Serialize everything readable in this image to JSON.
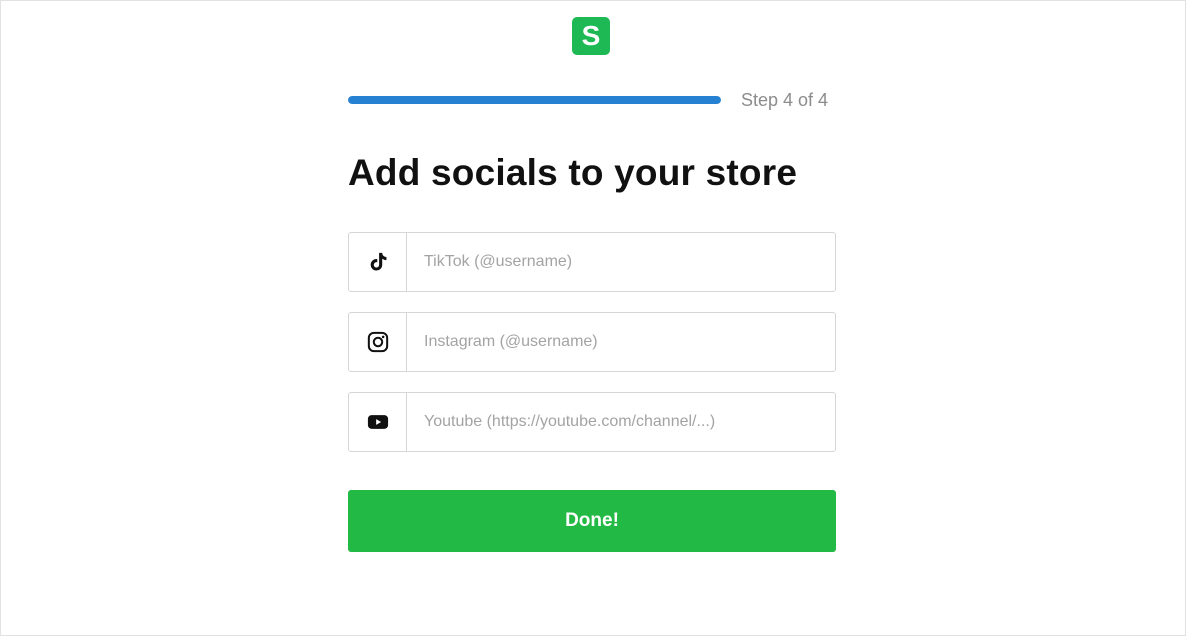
{
  "logo": {
    "letter": "S",
    "color": "#1eb955"
  },
  "progress": {
    "fraction": 1.0,
    "label": "Step 4 of 4",
    "fill_color": "#2681d2"
  },
  "title": "Add socials to your store",
  "fields": [
    {
      "icon": "tiktok-icon",
      "placeholder": "TikTok (@username)",
      "value": ""
    },
    {
      "icon": "instagram-icon",
      "placeholder": "Instagram (@username)",
      "value": ""
    },
    {
      "icon": "youtube-icon",
      "placeholder": "Youtube (https://youtube.com/channel/...)",
      "value": ""
    }
  ],
  "done_button": {
    "label": "Done!",
    "color": "#23b945"
  }
}
